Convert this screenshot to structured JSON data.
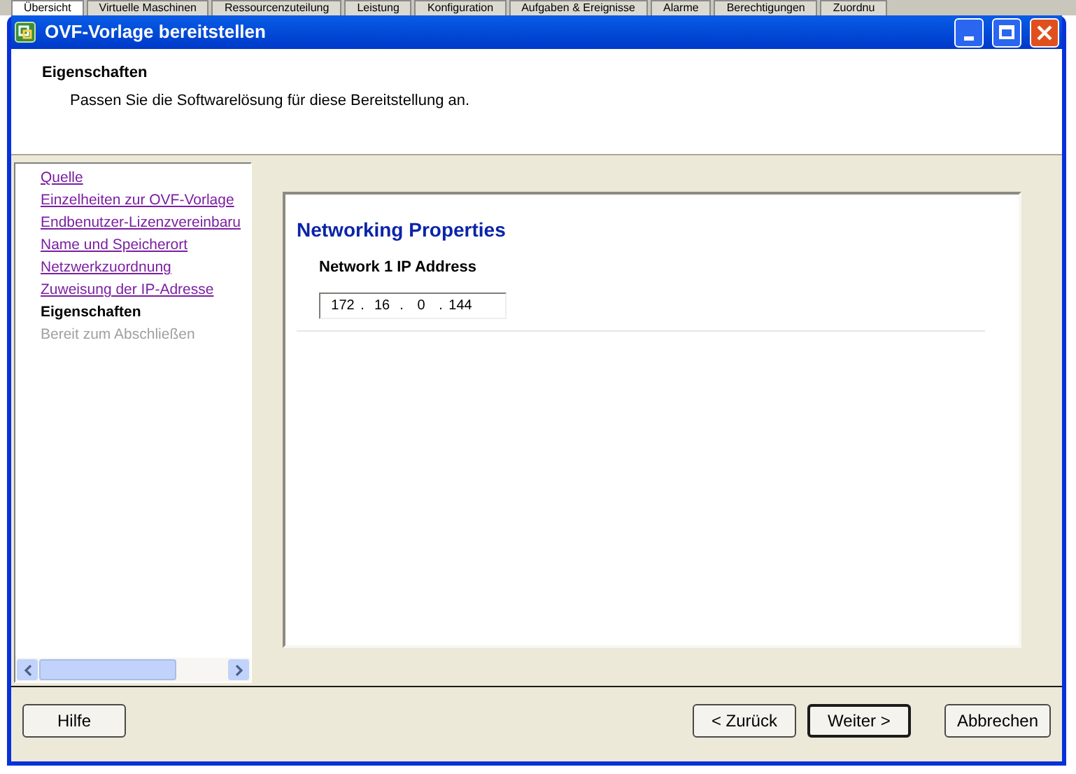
{
  "background_tabs": [
    {
      "label": "Übersicht",
      "selected": true
    },
    {
      "label": "Virtuelle Maschinen",
      "selected": false
    },
    {
      "label": "Ressourcenzuteilung",
      "selected": false
    },
    {
      "label": "Leistung",
      "selected": false
    },
    {
      "label": "Konfiguration",
      "selected": false
    },
    {
      "label": "Aufgaben & Ereignisse",
      "selected": false
    },
    {
      "label": "Alarme",
      "selected": false
    },
    {
      "label": "Berechtigungen",
      "selected": false
    },
    {
      "label": "Zuordnu",
      "selected": false
    }
  ],
  "window": {
    "title": "OVF-Vorlage bereitstellen"
  },
  "header": {
    "title": "Eigenschaften",
    "subtitle": "Passen Sie die Softwarelösung für diese Bereitstellung an."
  },
  "steps": [
    {
      "label": "Quelle",
      "kind": "done"
    },
    {
      "label": "Einzelheiten zur OVF-Vorlage",
      "kind": "done"
    },
    {
      "label": "Endbenutzer-Lizenzvereinbaru",
      "kind": "done"
    },
    {
      "label": "Name und Speicherort",
      "kind": "done"
    },
    {
      "label": "Netzwerkzuordnung",
      "kind": "done"
    },
    {
      "label": "Zuweisung der IP-Adresse",
      "kind": "done"
    },
    {
      "label": "Eigenschaften",
      "kind": "current"
    },
    {
      "label": "Bereit zum Abschließen",
      "kind": "pending"
    }
  ],
  "properties": {
    "section_title": "Networking Properties",
    "field_label": "Network 1 IP Address",
    "ip_octets": [
      "172",
      "16",
      "0",
      "144"
    ],
    "separator": "."
  },
  "buttons": {
    "help": "Hilfe",
    "back": "< Zurück",
    "next": "Weiter >",
    "cancel": "Abbrechen"
  }
}
